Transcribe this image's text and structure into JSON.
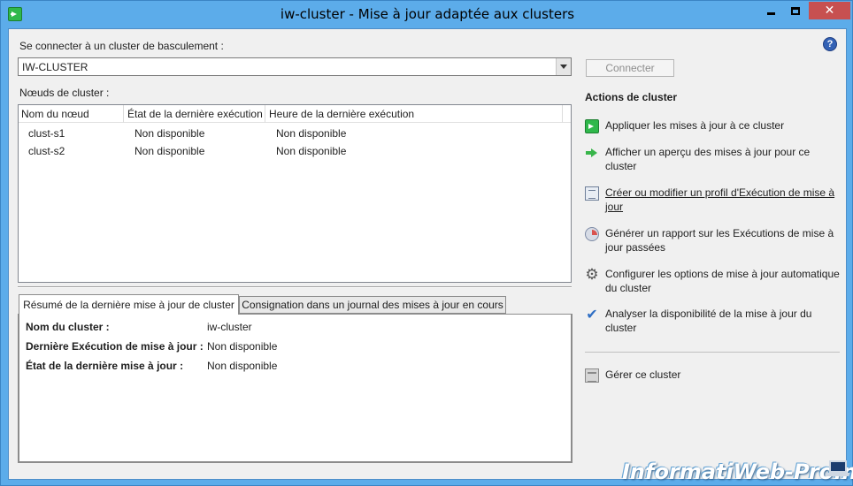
{
  "window": {
    "title": "iw-cluster - Mise à jour adaptée aux clusters",
    "minimize_glyph": "",
    "close_glyph": "✕"
  },
  "connect": {
    "label": "Se connecter à un cluster de basculement :",
    "selected_cluster": "IW-CLUSTER",
    "connect_button": "Connecter",
    "help_glyph": "?"
  },
  "nodes": {
    "label": "Nœuds de cluster :",
    "columns": [
      "Nom du nœud",
      "État de la dernière exécution",
      "Heure de la dernière exécution"
    ],
    "rows": [
      [
        "clust-s1",
        "Non disponible",
        "Non disponible"
      ],
      [
        "clust-s2",
        "Non disponible",
        "Non disponible"
      ]
    ]
  },
  "tabs": {
    "active": "Résumé de la dernière mise à jour de cluster",
    "inactive": "Consignation dans un journal des mises à jour en cours"
  },
  "summary": [
    {
      "key": "Nom du cluster :",
      "value": "iw-cluster"
    },
    {
      "key": "Dernière Exécution de mise à jour :",
      "value": "Non disponible"
    },
    {
      "key": "État de la dernière mise à jour :",
      "value": "Non disponible"
    }
  ],
  "actions": {
    "title": "Actions de cluster",
    "items": [
      {
        "label": "Appliquer les mises à jour à ce cluster",
        "icon": "apply-updates-icon"
      },
      {
        "label": "Afficher un aperçu des mises à jour pour ce cluster",
        "icon": "preview-arrow-icon"
      },
      {
        "label": "Créer ou modifier un profil d'Exécution de mise à jour",
        "icon": "profile-icon"
      },
      {
        "label": "Générer un rapport sur les Exécutions de mise à jour passées",
        "icon": "report-icon"
      },
      {
        "label": "Configurer les options de mise à jour automatique du cluster",
        "icon": "gear-icon"
      },
      {
        "label": "Analyser la disponibilité de la mise à jour du cluster",
        "icon": "checkmark-icon"
      },
      {
        "label": "Gérer ce cluster",
        "icon": "server-icon"
      }
    ]
  },
  "gear_glyph": "⚙",
  "check_glyph": "✔",
  "watermark": "InformatiWeb-Pro.net",
  "colors": {
    "titlebar": "#5cacea",
    "close_button": "#c75050",
    "client_bg": "#f0f0f0",
    "accent_green": "#2fb84b"
  }
}
